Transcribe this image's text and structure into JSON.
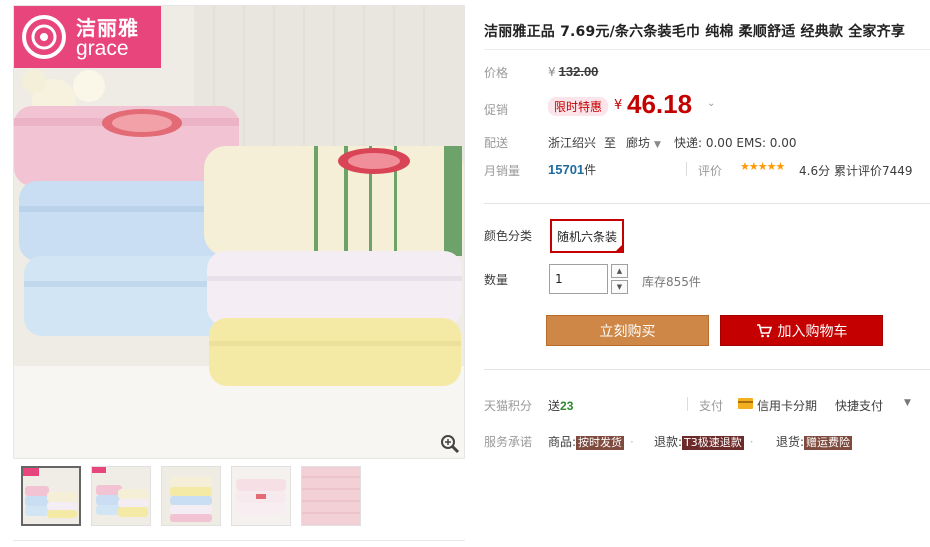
{
  "brand": {
    "name_cn": "洁丽雅",
    "name_en": "grace"
  },
  "gallery": {
    "zoom_icon": "magnifier-icon",
    "thumb_count": 5
  },
  "product": {
    "title": "洁丽雅正品 7.69元/条六条装毛巾 纯棉 柔顺舒适 经典款 全家齐享"
  },
  "price": {
    "label": "价格",
    "currency": "¥",
    "original": "132.00"
  },
  "promo": {
    "label": "促销",
    "badge": "限时特惠",
    "currency": "¥",
    "price": "46.18"
  },
  "shipping": {
    "label": "配送",
    "from": "浙江绍兴",
    "to_word": "至",
    "dest": "廊坊",
    "fee": "快递: 0.00 EMS: 0.00"
  },
  "sales": {
    "label": "月销量",
    "count": "15701",
    "unit": "件"
  },
  "rating": {
    "label": "评价",
    "stars": "★★★★★",
    "score": "4.6分",
    "total": "累计评价7449"
  },
  "color_choice": {
    "label": "颜色分类",
    "option": "随机六条装"
  },
  "quantity": {
    "label": "数量",
    "value": "1",
    "stock": "库存855件"
  },
  "actions": {
    "buy": "立刻购买",
    "cart": "加入购物车"
  },
  "points": {
    "label": "天猫积分",
    "prefix": "送",
    "value": "23"
  },
  "payment": {
    "label": "支付",
    "installment": "信用卡分期",
    "quickpay": "快捷支付"
  },
  "service": {
    "label": "服务承诺",
    "items": [
      {
        "prefix": "商品:",
        "tag": "按时发货",
        "color": "#7f4b3f"
      },
      {
        "prefix": "退款:",
        "tag": "T3极速退款",
        "color": "#6d2a2a"
      },
      {
        "prefix": "退货:",
        "tag": "赠运费险",
        "color": "#7f4b3f"
      }
    ]
  },
  "colors": {
    "accent_red": "#c40000",
    "buy_orange": "#ce8746",
    "brand_pink": "#e8457c"
  }
}
